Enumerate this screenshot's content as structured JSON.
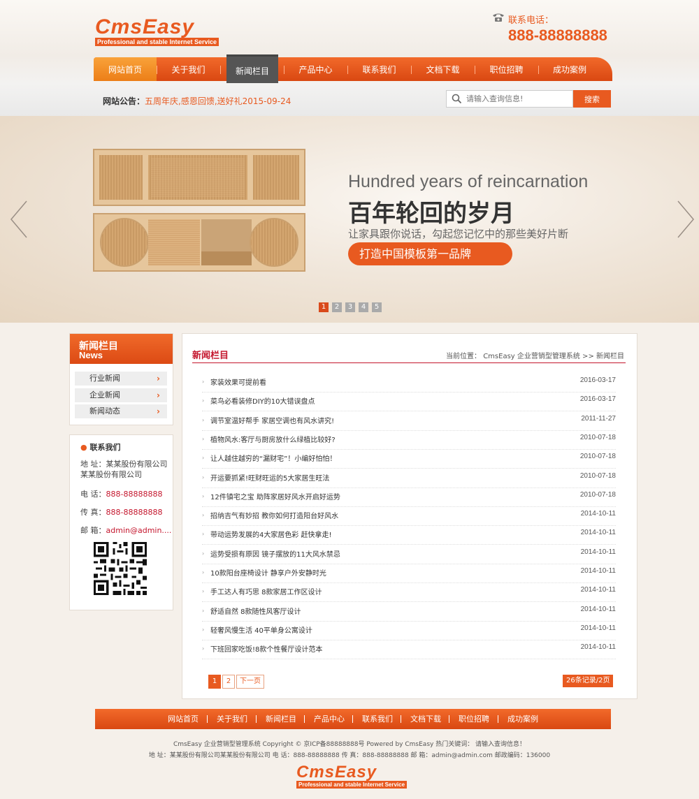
{
  "header": {
    "logo_text": "CmsEasy",
    "logo_tagline": "Professional and stable Internet Service",
    "phone_label": "联系电话：",
    "phone_number": "888-88888888"
  },
  "nav": {
    "items": [
      "网站首页",
      "关于我们",
      "新闻栏目",
      "产品中心",
      "联系我们",
      "文档下载",
      "职位招聘",
      "成功案例"
    ],
    "active": "新闻栏目"
  },
  "notice": {
    "label": "网站公告：",
    "text": "五周年庆,感恩回馈,送好礼2015-09-24"
  },
  "search": {
    "placeholder": "请输入查询信息!",
    "button": "搜索"
  },
  "banner": {
    "title_en": "Hundred years of reincarnation",
    "title_cn": "百年轮回的岁月",
    "subtitle": "让家具跟你说话，勾起您记忆中的那些美好片断",
    "button": "打造中国模板第一品牌",
    "pages": [
      "1",
      "2",
      "3",
      "4",
      "5"
    ],
    "active_page": "1"
  },
  "sidebar": {
    "category_title": "新闻栏目",
    "category_en": "News",
    "items": [
      "行业新闻",
      "企业新闻",
      "新闻动态"
    ],
    "contact_title": "联系我们",
    "address_label": "地 址：",
    "address": "某某股份有限公司",
    "address_line2": "某某股份有限公司",
    "tel_label": "电 话：",
    "tel": "888-88888888",
    "fax_label": "传 真：",
    "fax": "888-88888888",
    "email_label": "邮 箱：",
    "email": "admin@admin...."
  },
  "main": {
    "title": "新闻栏目",
    "breadcrumb": "当前位置： CmsEasy 企业营销型管理系统  >>  新闻栏目",
    "news": [
      {
        "title": "家装效果可提前看",
        "date": "2016-03-17"
      },
      {
        "title": "菜鸟必看装修DIY的10大错误盘点",
        "date": "2016-03-17"
      },
      {
        "title": "调节室温好帮手 家居空调也有风水讲究!",
        "date": "2011-11-27"
      },
      {
        "title": "植物风水:客厅与厨房放什么绿植比较好?",
        "date": "2010-07-18"
      },
      {
        "title": "让人越住越穷的“漏财宅”！小编好怕怕！",
        "date": "2010-07-18"
      },
      {
        "title": "开运要抓紧!旺财旺运的5大家居生旺法",
        "date": "2010-07-18"
      },
      {
        "title": "12件镇宅之宝 助阵家居好风水开启好运势",
        "date": "2010-07-18"
      },
      {
        "title": "招纳吉气有妙招 教你如何打造阳台好风水",
        "date": "2014-10-11"
      },
      {
        "title": "带动运势发展的4大家居色彩 赶快拿走!",
        "date": "2014-10-11"
      },
      {
        "title": "运势受损有原因 镜子摆放的11大风水禁忌",
        "date": "2014-10-11"
      },
      {
        "title": "10款阳台座椅设计 静享户外安静时光",
        "date": "2014-10-11"
      },
      {
        "title": "手工达人有巧思 8款家居工作区设计",
        "date": "2014-10-11"
      },
      {
        "title": "舒适自然 8款随性风客厅设计",
        "date": "2014-10-11"
      },
      {
        "title": "轻奢风慢生活 40平单身公寓设计",
        "date": "2014-10-11"
      },
      {
        "title": "下班回家吃饭!8款个性餐厅设计范本",
        "date": "2014-10-11"
      }
    ],
    "pager": {
      "pages": [
        "1",
        "2"
      ],
      "next": "下一页",
      "count": "26条记录/2页"
    }
  },
  "footer": {
    "nav": [
      "网站首页",
      "关于我们",
      "新闻栏目",
      "产品中心",
      "联系我们",
      "文档下载",
      "职位招聘",
      "成功案例"
    ],
    "line1": "CmsEasy 企业营销型管理系统  Copyright ©  京ICP备88888888号   Powered by CmsEasy  热门关键词： 请输入查询信息！",
    "line2": "地 址：某某股份有限公司某某股份有限公司  电 话：888-88888888  传 真：888-88888888  邮 箱：admin@admin.com   邮政编码：136000"
  },
  "colors": {
    "accent": "#e85a20",
    "dark_accent": "#c4162d",
    "nav_active": "#555555"
  }
}
